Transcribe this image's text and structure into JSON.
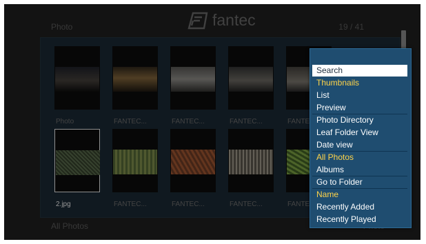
{
  "header": {
    "section": "Photo",
    "counter": "19 / 41",
    "brand": "fantec"
  },
  "footer": {
    "filter": "All Photos",
    "info": "Photo"
  },
  "grid": {
    "rows": [
      [
        {
          "caption": "Photo",
          "image": "night-city-skyline"
        },
        {
          "caption": "FANTEC...",
          "image": "sunset-harbor"
        },
        {
          "caption": "FANTEC...",
          "image": "grey-landscape"
        },
        {
          "caption": "FANTEC...",
          "image": "industrial-scene"
        },
        {
          "caption": "FANTEC...",
          "image": "mountain-view"
        }
      ],
      [
        {
          "caption": "2.jpg",
          "image": "mossy-texture",
          "selected": true
        },
        {
          "caption": "FANTEC...",
          "image": "tree-forest"
        },
        {
          "caption": "FANTEC...",
          "image": "autumn-leaves"
        },
        {
          "caption": "FANTEC...",
          "image": "birch-trees"
        },
        {
          "caption": "FANTEC...",
          "image": "green-plant"
        }
      ]
    ]
  },
  "context_menu": {
    "items": [
      {
        "label": "Search",
        "state": "focused"
      },
      {
        "label": "Thumbnails",
        "state": "active"
      },
      {
        "label": "List",
        "state": "normal"
      },
      {
        "label": "Preview",
        "state": "normal"
      },
      {
        "label": "Photo Directory",
        "state": "normal"
      },
      {
        "label": "Leaf Folder View",
        "state": "normal"
      },
      {
        "label": "Date view",
        "state": "normal"
      },
      {
        "label": "All Photos",
        "state": "active"
      },
      {
        "label": "Albums",
        "state": "normal"
      },
      {
        "label": "Go to Folder",
        "state": "normal"
      },
      {
        "label": "Name",
        "state": "active"
      },
      {
        "label": "Recently Added",
        "state": "normal"
      },
      {
        "label": "Recently Played",
        "state": "normal"
      }
    ]
  },
  "colors": {
    "menu_background": "#1f4d70",
    "active_item": "#ffd44a",
    "focused_item_background": "#ffffff"
  }
}
